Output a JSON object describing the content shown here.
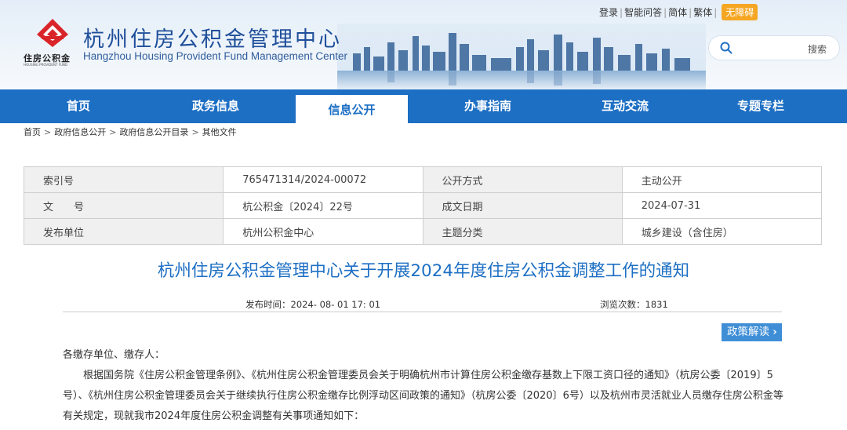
{
  "header": {
    "site_name_cn": "杭州住房公积金管理中心",
    "site_name_en": "Hangzhou Housing Provident Fund Management Center",
    "logo_text": "住房公积金",
    "logo_tiny": "HOUSING PROVIDENT FUND",
    "top_links": [
      "登录",
      "智能问答",
      "简体",
      "繁体"
    ],
    "accessibility_label": "无障碍",
    "search_button": "搜索"
  },
  "nav": {
    "items": [
      "首页",
      "政务信息",
      "信息公开",
      "办事指南",
      "互动交流",
      "专题专栏"
    ],
    "active_index": 2
  },
  "breadcrumb": [
    "首页",
    "政府信息公开",
    "政府信息公开目录",
    "其他文件"
  ],
  "meta": {
    "rows": [
      [
        "索引号",
        "765471314/2024-00072",
        "公开方式",
        "主动公开"
      ],
      [
        "文　　号",
        "杭公积金〔2024〕22号",
        "成文日期",
        "2024-07-31"
      ],
      [
        "发布单位",
        "杭州公积金中心",
        "主题分类",
        "城乡建设（含住房）"
      ]
    ]
  },
  "article": {
    "title": "杭州住房公积金管理中心关于开展2024年度住房公积金调整工作的通知",
    "publish_label": "发布时间：",
    "publish_time": "2024- 08- 01 17: 01",
    "views_label": "浏览次数：",
    "views": "1831",
    "interpretation_button": "政策解读",
    "salutation": "各缴存单位、缴存人：",
    "paragraph": "根据国务院《住房公积金管理条例》、《杭州住房公积金管理委员会关于明确杭州市计算住房公积金缴存基数上下限工资口径的通知》（杭房公委〔2019〕5号）、《杭州住房公积金管理委员会关于继续执行住房公积金缴存比例浮动区间政策的通知》（杭房公委〔2020〕6号）以及杭州市灵活就业人员缴存住房公积金等有关规定，现就我市2024年度住房公积金调整有关事项通知如下："
  },
  "colors": {
    "primary": "#1d6fc4",
    "accent": "#f5a623"
  }
}
